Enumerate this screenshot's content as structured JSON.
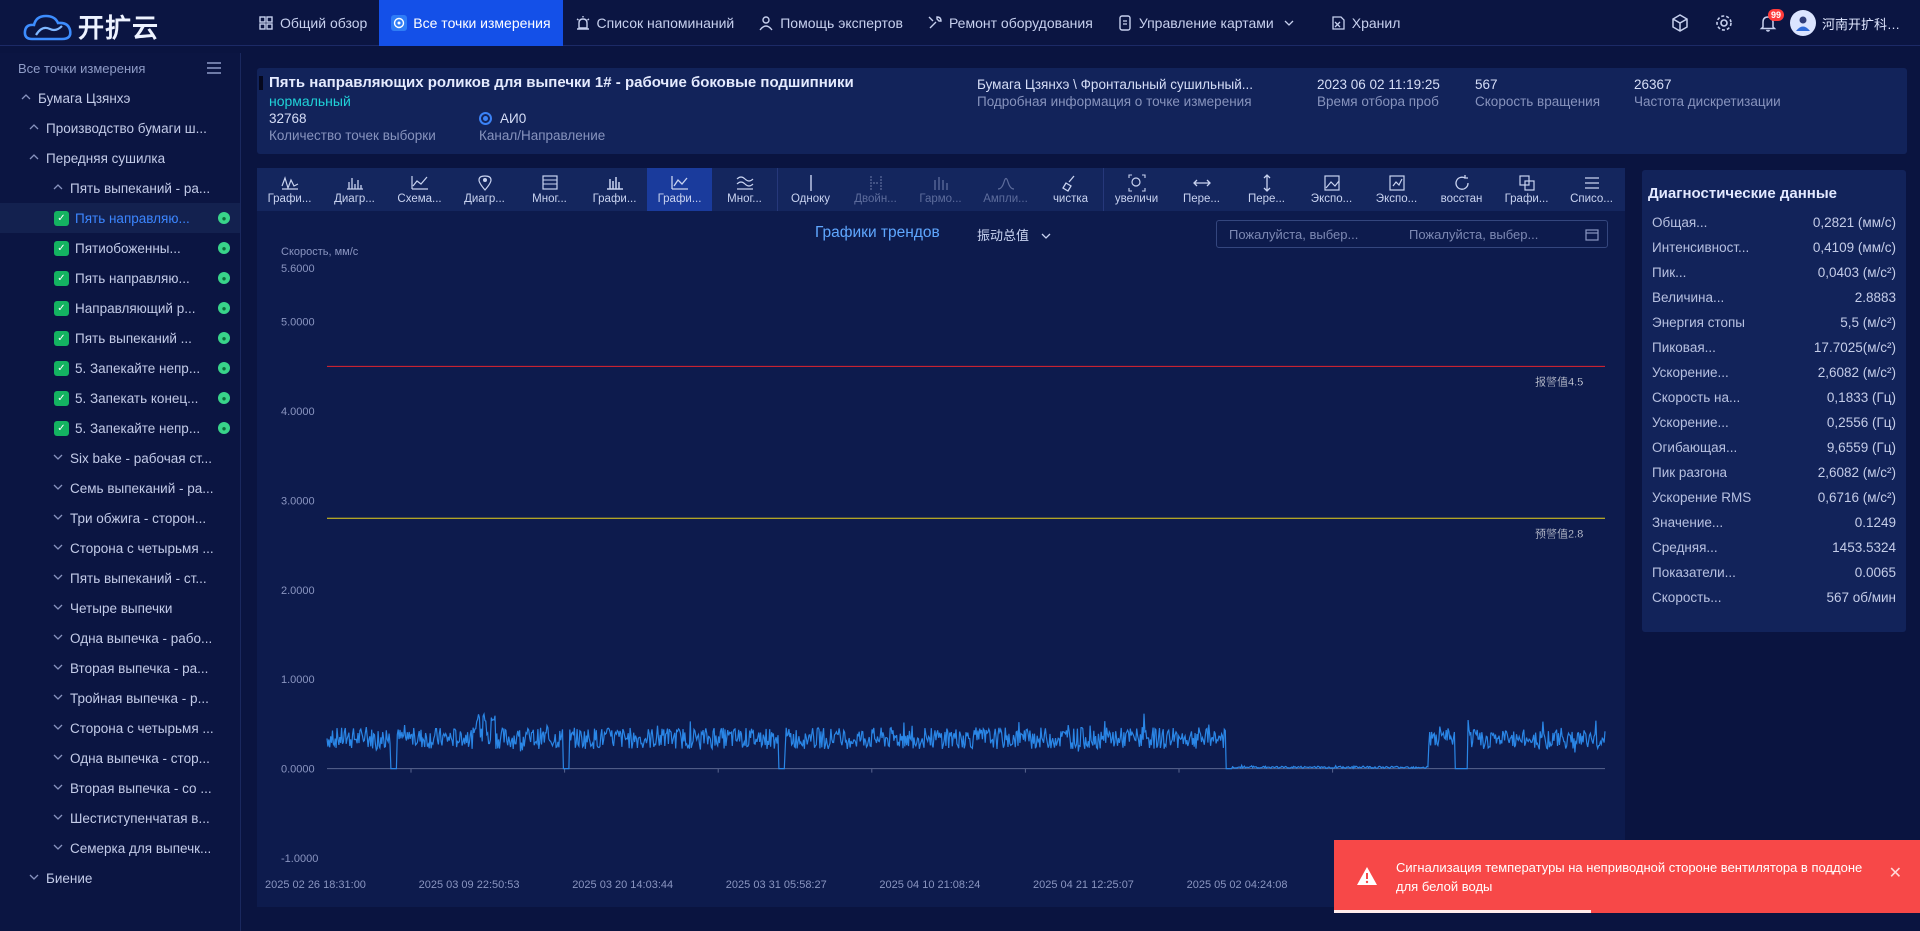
{
  "app": {
    "logo_text": "开扩云"
  },
  "nav": [
    {
      "label": "Общий обзор",
      "icon": "grid-icon"
    },
    {
      "label": "Все точки измерения",
      "icon": "target-icon",
      "active": true
    },
    {
      "label": "Список напоминаний",
      "icon": "alarm-icon"
    },
    {
      "label": "Помощь экспертов",
      "icon": "expert-icon"
    },
    {
      "label": "Ремонт оборудования",
      "icon": "wrench-icon"
    },
    {
      "label": "Управление картами",
      "icon": "card-icon"
    },
    {
      "label": "Хранил",
      "icon": "storage-icon"
    }
  ],
  "header_right": {
    "notification_count": "99",
    "user_name": "河南开扩科…"
  },
  "sidebar": {
    "title": "Все точки измерения",
    "tree": [
      {
        "label": "Бумага Цзянхэ",
        "level": 0,
        "chev": "up"
      },
      {
        "label": "Производство бумаги ш...",
        "level": 1,
        "chev": "up"
      },
      {
        "label": "Передняя сушилка",
        "level": 1,
        "chev": "up"
      },
      {
        "label": "Пять выпеканий - ра...",
        "level": 2,
        "chev": "up"
      },
      {
        "label": "Пять направляю...",
        "level": 3,
        "leaf": true,
        "selected": true
      },
      {
        "label": "Пятиобоженны...",
        "level": 3,
        "leaf": true
      },
      {
        "label": "Пять направляю...",
        "level": 3,
        "leaf": true
      },
      {
        "label": "Направляющий р...",
        "level": 3,
        "leaf": true
      },
      {
        "label": "Пять выпеканий ...",
        "level": 3,
        "leaf": true
      },
      {
        "label": "5. Запекайте непр...",
        "level": 3,
        "leaf": true
      },
      {
        "label": "5. Запекать конец...",
        "level": 3,
        "leaf": true
      },
      {
        "label": "5. Запекайте непр...",
        "level": 3,
        "leaf": true
      },
      {
        "label": "Six bake - рабочая ст...",
        "level": 2,
        "chev": "down"
      },
      {
        "label": "Семь выпеканий - ра...",
        "level": 2,
        "chev": "down"
      },
      {
        "label": "Три обжига - сторон...",
        "level": 2,
        "chev": "down"
      },
      {
        "label": "Сторона с четырьмя ...",
        "level": 2,
        "chev": "down"
      },
      {
        "label": "Пять выпеканий - ст...",
        "level": 2,
        "chev": "down"
      },
      {
        "label": "Четыре выпечки",
        "level": 2,
        "chev": "down"
      },
      {
        "label": "Одна выпечка - рабо...",
        "level": 2,
        "chev": "down"
      },
      {
        "label": "Вторая выпечка - ра...",
        "level": 2,
        "chev": "down"
      },
      {
        "label": "Тройная выпечка - р...",
        "level": 2,
        "chev": "down"
      },
      {
        "label": "Сторона с четырьмя ...",
        "level": 2,
        "chev": "down"
      },
      {
        "label": "Одна выпечка - стор...",
        "level": 2,
        "chev": "down"
      },
      {
        "label": "Вторая выпечка - со ...",
        "level": 2,
        "chev": "down"
      },
      {
        "label": "Шестиступенчатая в...",
        "level": 2,
        "chev": "down"
      },
      {
        "label": "Семерка для выпечк...",
        "level": 2,
        "chev": "down"
      },
      {
        "label": "Биение",
        "level": 1,
        "chev": "down"
      }
    ]
  },
  "info": {
    "title": "Пять направляющих роликов для выпечки 1# - рабочие боковые подшипники",
    "status": "нормальный",
    "sample_points_value": "32768",
    "sample_points_label": "Количество точек выборки",
    "channel_value": "АИ0",
    "channel_label": "Канал/Направление",
    "path_value": "Бумага Цзянхэ \\ Фронтальный сушильный...",
    "path_label": "Подробная информация о точке измерения",
    "time_value": "2023 06 02 11:19:25",
    "time_label": "Время отбора проб",
    "speed_value": "567",
    "speed_label": "Скорость вращения",
    "freq_value": "26367",
    "freq_label": "Частота дискретизации"
  },
  "toolbar": [
    {
      "label": "Графи...",
      "icon": "waveform-icon"
    },
    {
      "label": "Диагр...",
      "icon": "spectrum-icon"
    },
    {
      "label": "Схема...",
      "icon": "diagram-icon"
    },
    {
      "label": "Диагр...",
      "icon": "location-icon"
    },
    {
      "label": "Мног...",
      "icon": "multi-chart-icon"
    },
    {
      "label": "Графи...",
      "icon": "bar-chart-icon"
    },
    {
      "label": "Графи...",
      "icon": "trend-icon",
      "active": true
    },
    {
      "label": "Мног...",
      "icon": "multi-wave-icon"
    },
    {
      "label": "Одноку",
      "icon": "single-cursor-icon",
      "sep_before": true
    },
    {
      "label": "Двойн...",
      "icon": "double-cursor-icon",
      "disabled": true
    },
    {
      "label": "Гармо...",
      "icon": "harmonic-icon",
      "disabled": true
    },
    {
      "label": "Ампли...",
      "icon": "amplitude-icon",
      "disabled": true
    },
    {
      "label": "чистка",
      "icon": "broom-icon"
    },
    {
      "label": "увеличи",
      "icon": "zoom-icon",
      "sep_before": true
    },
    {
      "label": "Пере...",
      "icon": "horizontal-move-icon"
    },
    {
      "label": "Пере...",
      "icon": "vertical-move-icon"
    },
    {
      "label": "Экспо...",
      "icon": "export-image-icon"
    },
    {
      "label": "Экспо...",
      "icon": "export-data-icon"
    },
    {
      "label": "восстан",
      "icon": "restore-icon"
    },
    {
      "label": "Графи...",
      "icon": "overlay-icon"
    },
    {
      "label": "Списо...",
      "icon": "list-icon"
    }
  ],
  "chart_header": {
    "title": "Графики трендов",
    "select_value": "振动总值",
    "date_start_placeholder": "Пожалуйста, выбер...",
    "date_end_placeholder": "Пожалуйста, выбер..."
  },
  "chart_data": {
    "type": "line",
    "ylabel": "Скорость, мм/с",
    "ylim": [
      -1.0,
      5.6
    ],
    "y_ticks": [
      "5.6000",
      "5.0000",
      "4.0000",
      "3.0000",
      "2.0000",
      "1.0000",
      "0.0000",
      "-1.0000"
    ],
    "y_tick_values": [
      5.6,
      5.0,
      4.0,
      3.0,
      2.0,
      1.0,
      0.0,
      -1.0
    ],
    "x_ticks": [
      "2025 02 26 18:31:00",
      "2025 03 09 22:50:53",
      "2025 03 20 14:03:44",
      "2025 03 31 05:58:27",
      "2025 04 10 21:08:24",
      "2025 04 21 12:25:07",
      "2025 05 02 04:24:08"
    ],
    "thresholds": [
      {
        "label": "报警值4.5",
        "value": 4.5,
        "color": "#e0232e"
      },
      {
        "label": "预警值2.8",
        "value": 2.8,
        "color": "#e8d21a"
      }
    ],
    "series": [
      {
        "color": "#2a86e6",
        "segments": [
          {
            "from": 0.0,
            "to": 0.706,
            "mean": 0.34,
            "amp": 0.12
          },
          {
            "from": 0.706,
            "to": 0.862,
            "mean": 0.015,
            "amp": 0.012
          },
          {
            "from": 0.862,
            "to": 1.0,
            "mean": 0.33,
            "amp": 0.11
          }
        ],
        "dips": [
          0.052,
          0.187,
          0.356,
          0.706,
          0.885,
          0.89
        ],
        "peaks": [
          0.118,
          0.123,
          0.13
        ]
      }
    ]
  },
  "diagnostics": {
    "title": "Диагностические данные",
    "rows": [
      {
        "label": "Общая...",
        "value": "0,2821 (мм/с)"
      },
      {
        "label": "Интенсивност...",
        "value": "0,4109 (мм/с)"
      },
      {
        "label": "Пик...",
        "value": "0,0403 (м/с²)"
      },
      {
        "label": "Величина...",
        "value": "2.8883"
      },
      {
        "label": "Энергия стопы",
        "value": "5,5 (м/с²)"
      },
      {
        "label": "Пиковая...",
        "value": "17.7025(м/с²)"
      },
      {
        "label": "Ускорение...",
        "value": "2,6082 (м/с²)"
      },
      {
        "label": "Скорость на...",
        "value": "0,1833 (Гц)"
      },
      {
        "label": "Ускорение...",
        "value": "0,2556 (Гц)"
      },
      {
        "label": "Огибающая...",
        "value": "9,6559 (Гц)"
      },
      {
        "label": "Пик разгона",
        "value": "2,6082 (м/с²)"
      },
      {
        "label": "Ускорение RMS",
        "value": "0,6716 (м/с²)"
      },
      {
        "label": "Значение...",
        "value": "0.1249"
      },
      {
        "label": "Средняя...",
        "value": "1453.5324"
      },
      {
        "label": "Показатели...",
        "value": "0.0065"
      },
      {
        "label": "Скорость...",
        "value": "567 об/мин"
      }
    ]
  },
  "toast": {
    "message": "Сигнализация температуры на неприводной стороне вентилятора в поддоне для белой воды"
  }
}
